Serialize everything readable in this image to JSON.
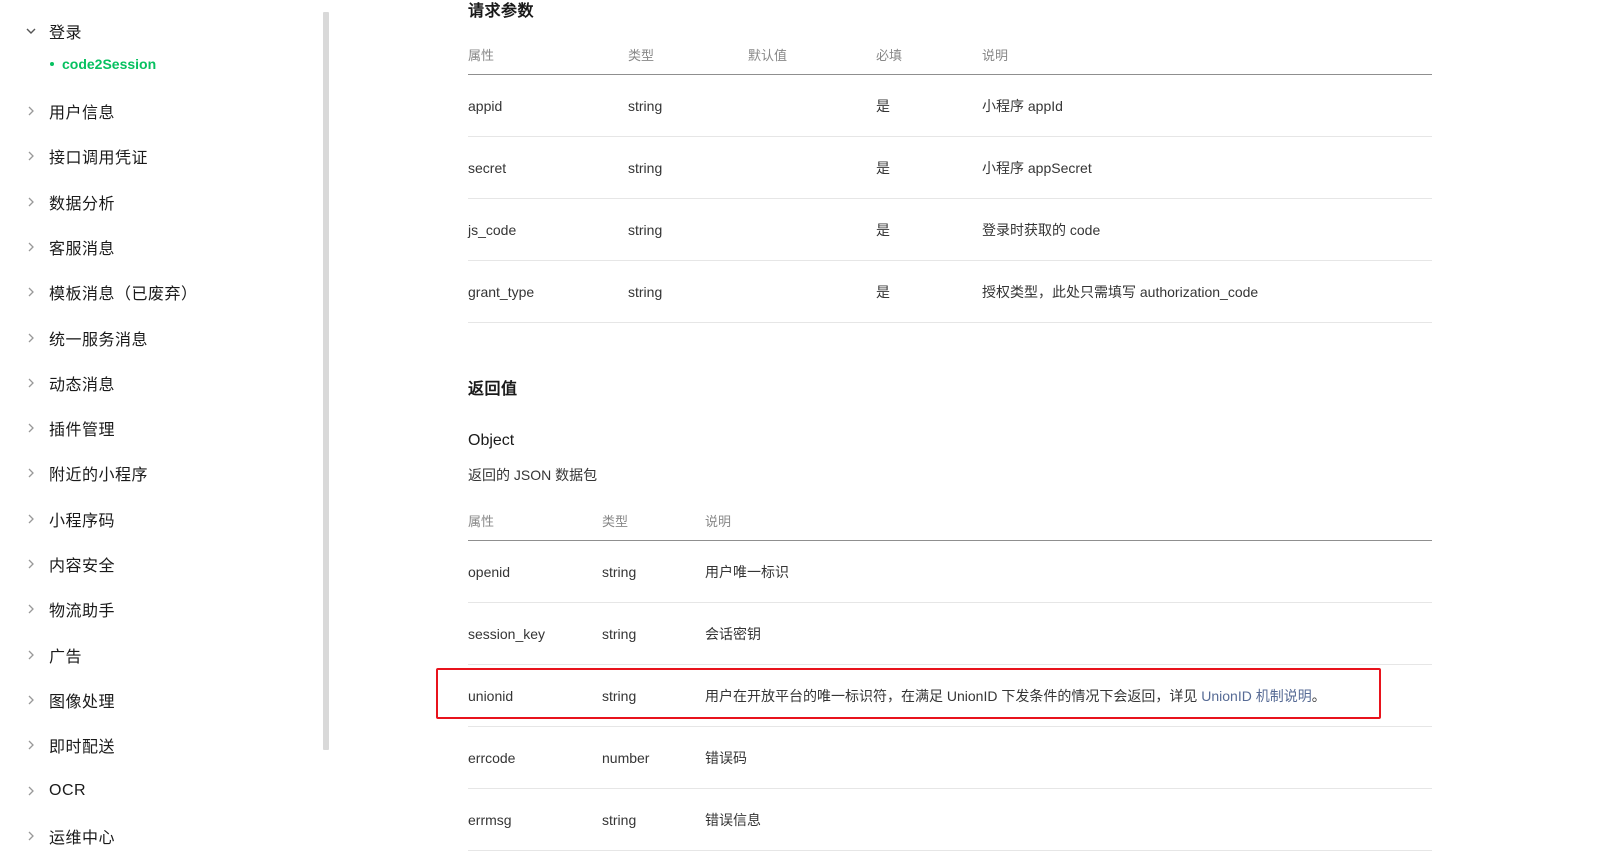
{
  "sidebar": {
    "expanded": {
      "label": "登录",
      "child": "code2Session"
    },
    "items": [
      "用户信息",
      "接口调用凭证",
      "数据分析",
      "客服消息",
      "模板消息（已废弃）",
      "统一服务消息",
      "动态消息",
      "插件管理",
      "附近的小程序",
      "小程序码",
      "内容安全",
      "物流助手",
      "广告",
      "图像处理",
      "即时配送",
      "OCR",
      "运维中心"
    ]
  },
  "request": {
    "title": "请求参数",
    "headers": [
      "属性",
      "类型",
      "默认值",
      "必填",
      "说明"
    ],
    "rows": [
      [
        "appid",
        "string",
        "",
        "是",
        "小程序 appId"
      ],
      [
        "secret",
        "string",
        "",
        "是",
        "小程序 appSecret"
      ],
      [
        "js_code",
        "string",
        "",
        "是",
        "登录时获取的 code"
      ],
      [
        "grant_type",
        "string",
        "",
        "是",
        "授权类型，此处只需填写 authorization_code"
      ]
    ]
  },
  "response": {
    "title": "返回值",
    "object_title": "Object",
    "object_desc": "返回的 JSON 数据包",
    "headers": [
      "属性",
      "类型",
      "说明"
    ],
    "rows": [
      [
        "openid",
        "string",
        "用户唯一标识"
      ],
      [
        "session_key",
        "string",
        "会话密钥"
      ],
      [
        "unionid",
        "string",
        "用户在开放平台的唯一标识符，在满足 UnionID 下发条件的情况下会返回，详见 "
      ],
      [
        "errcode",
        "number",
        "错误码"
      ],
      [
        "errmsg",
        "string",
        "错误信息"
      ]
    ],
    "unionid_link": "UnionID 机制说明",
    "unionid_suffix": "。"
  },
  "colors": {
    "accent": "#07c160",
    "link": "#576b95",
    "highlight": "#e8131c"
  }
}
